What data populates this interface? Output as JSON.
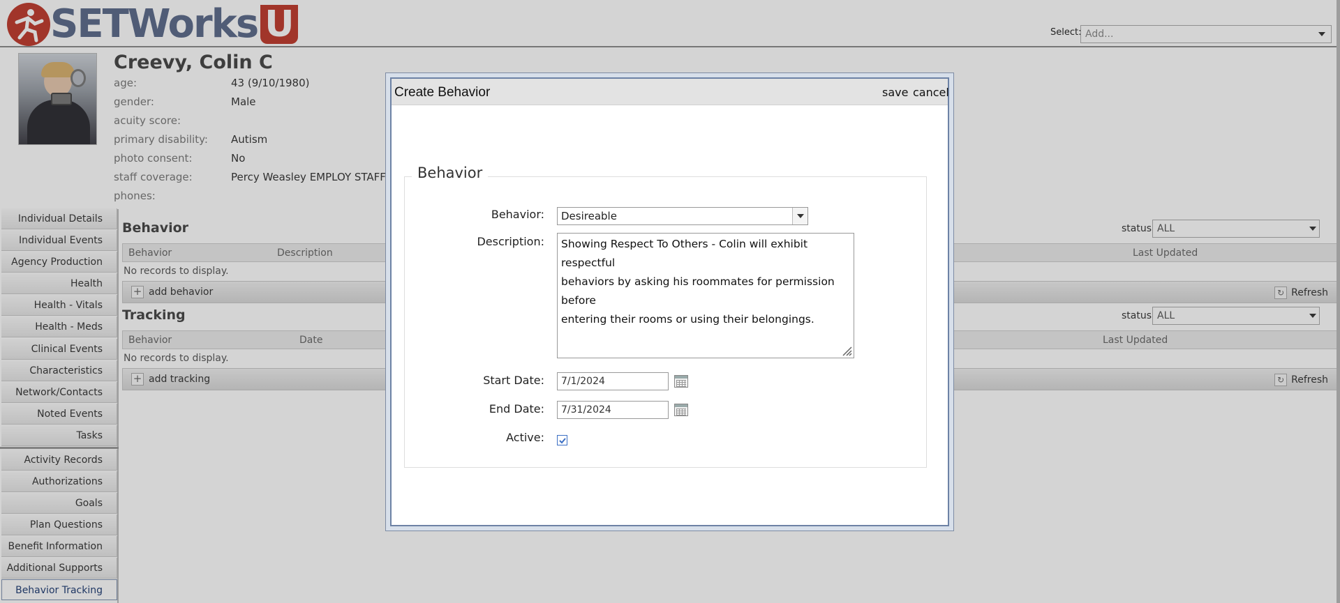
{
  "header": {
    "logo_text": "SETWorks",
    "logo_u": "U",
    "select_label": "Select:",
    "select_placeholder": "Add..."
  },
  "profile": {
    "name": "Creevy, Colin C",
    "fields": [
      {
        "label": "age:",
        "value": "43 (9/10/1980)"
      },
      {
        "label": "gender:",
        "value": "Male"
      },
      {
        "label": "acuity score:",
        "value": ""
      },
      {
        "label": "primary disability:",
        "value": "Autism"
      },
      {
        "label": "photo consent:",
        "value": "No"
      },
      {
        "label": "staff coverage:",
        "value": "Percy Weasley EMPLOY STAFF"
      },
      {
        "label": "phones:",
        "value": ""
      }
    ]
  },
  "nav": {
    "items": [
      "Individual Details",
      "Individual Events",
      "Agency Production",
      "Health",
      "Health - Vitals",
      "Health - Meds",
      "Clinical Events",
      "Characteristics",
      "Network/Contacts",
      "Noted Events",
      "Tasks",
      "Activity Records",
      "Authorizations",
      "Goals",
      "Plan Questions",
      "Benefit Information",
      "Additional Supports",
      "Behavior Tracking"
    ],
    "active": "Behavior Tracking"
  },
  "behavior_section": {
    "title": "Behavior",
    "status_label": "status:",
    "status_value": "ALL",
    "columns": [
      "Behavior",
      "Description",
      "Last Updated"
    ],
    "empty_text": "No records to display.",
    "add_label": "add behavior",
    "refresh_label": "Refresh"
  },
  "tracking_section": {
    "title": "Tracking",
    "status_label": "status:",
    "status_value": "ALL",
    "columns": [
      "Behavior",
      "Date",
      "Last Updated"
    ],
    "empty_text": "No records to display.",
    "add_label": "add tracking",
    "refresh_label": "Refresh"
  },
  "dialog": {
    "title": "Create Behavior",
    "save_label": "save",
    "cancel_label": "cancel",
    "legend": "Behavior",
    "behavior_label": "Behavior:",
    "behavior_value": "Desireable",
    "description_label": "Description:",
    "description_lines": [
      "Showing Respect To Others - Colin will exhibit respectful",
      "behaviors by asking his roommates for permission before",
      "entering their rooms or using their belongings."
    ],
    "start_date_label": "Start Date:",
    "start_date_value": "7/1/2024",
    "end_date_label": "End Date:",
    "end_date_value": "7/31/2024",
    "active_label": "Active:",
    "active_checked": true
  },
  "colors": {
    "brand_red": "#c0392b",
    "brand_slate": "#5a6a8a",
    "dialog_border": "#6d82a5",
    "checkbox_blue": "#3b6fc4"
  }
}
